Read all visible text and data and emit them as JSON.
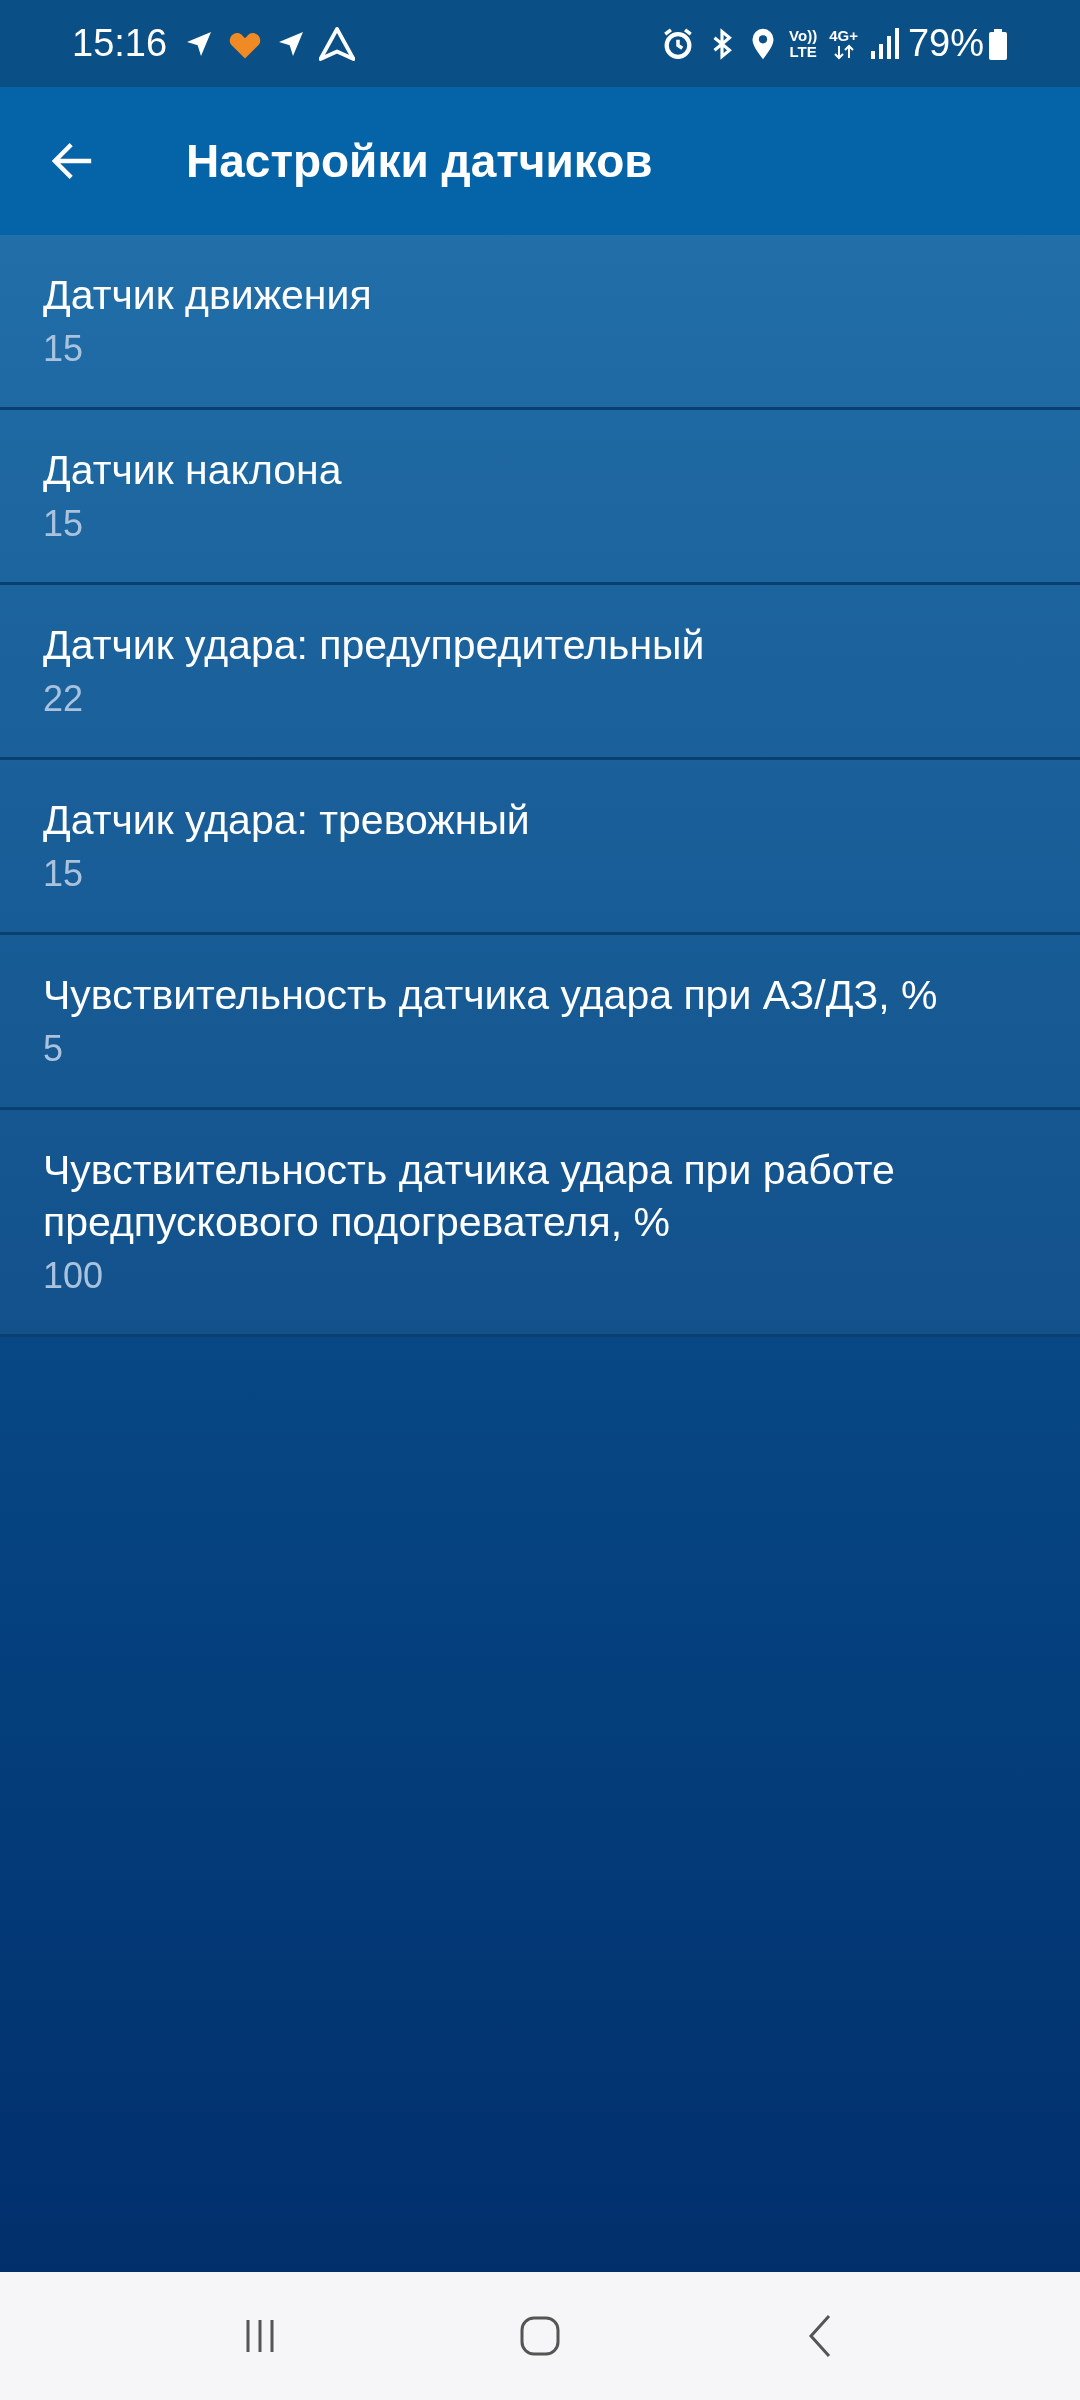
{
  "status_bar": {
    "time": "15:16",
    "volte": "Vo))\nLTE",
    "network": "4G+",
    "battery": "79%"
  },
  "app_bar": {
    "title": "Настройки датчиков"
  },
  "settings": [
    {
      "title": "Датчик движения",
      "value": "15"
    },
    {
      "title": "Датчик наклона",
      "value": "15"
    },
    {
      "title": "Датчик удара: предупредительный",
      "value": "22"
    },
    {
      "title": "Датчик удара: тревожный",
      "value": "15"
    },
    {
      "title": "Чувствительность датчика удара при АЗ/ДЗ, %",
      "value": "5"
    },
    {
      "title": "Чувствительность датчика удара при работе предпускового подогревателя, %",
      "value": "100"
    }
  ]
}
